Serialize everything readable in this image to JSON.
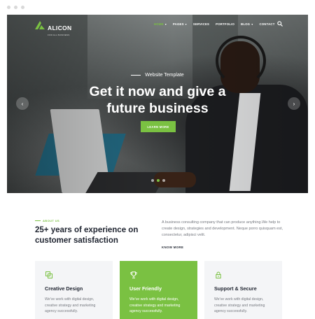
{
  "brand": {
    "name": "ALICON",
    "tagline": "FOR ALL BUSINESS",
    "accent": "#7ac142"
  },
  "nav": {
    "items": [
      {
        "label": "HOME",
        "active": true,
        "dropdown": true
      },
      {
        "label": "PAGES",
        "active": false,
        "dropdown": true
      },
      {
        "label": "SERVICES",
        "active": false,
        "dropdown": false
      },
      {
        "label": "PORTFOLIO",
        "active": false,
        "dropdown": false
      },
      {
        "label": "BLOG",
        "active": false,
        "dropdown": true
      },
      {
        "label": "CONTACT",
        "active": false,
        "dropdown": false
      }
    ],
    "search_icon": "search-icon"
  },
  "hero": {
    "subtitle": "Website Template",
    "title_line1": "Get it now and give a",
    "title_line2": "future business",
    "button": "LEARN MORE",
    "prev_icon": "chevron-left-icon",
    "next_icon": "chevron-right-icon",
    "slides": 3,
    "active_slide": 2
  },
  "about": {
    "label": "ABOUT US",
    "title": "25+ years of experience on customer satisfaction",
    "text": "A business consulting company that can produce anything.We help to create design, strategies and development. Neque porro quisquam est, consectetur, adipisci velit.",
    "link": "KNOW MORE"
  },
  "features": [
    {
      "title": "Creative Design",
      "text": "We've work with digital design, creative strategy and marketing agency successfully.",
      "icon": "layers-icon"
    },
    {
      "title": "User Friendly",
      "text": "We've work with digital design, creative strategy and marketing agency successfully.",
      "icon": "trophy-icon"
    },
    {
      "title": "Support & Secure",
      "text": "We've work with digital design, creative strategy and marketing agency successfully.",
      "icon": "lock-icon"
    }
  ]
}
